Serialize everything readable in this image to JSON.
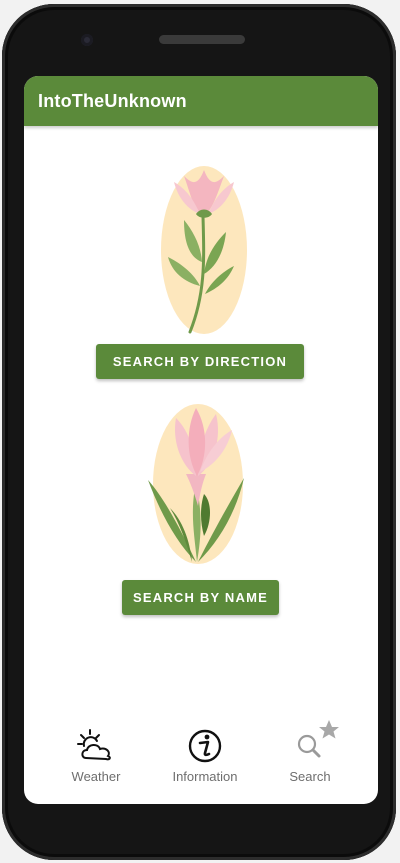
{
  "app_bar": {
    "title": "IntoTheUnknown"
  },
  "main": {
    "search_by_direction_label": "SEARCH BY DIRECTION",
    "search_by_name_label": "SEARCH BY NAME"
  },
  "bottom_nav": {
    "items": [
      {
        "label": "Weather",
        "icon": "weather-icon"
      },
      {
        "label": "Information",
        "icon": "info-icon"
      },
      {
        "label": "Search",
        "icon": "search-icon"
      }
    ]
  },
  "colors": {
    "primary": "#5b8a3a",
    "flower_pink": "#f4b6c0",
    "flower_backdrop": "#fde7bd",
    "leaf_green": "#6f9a4a"
  }
}
